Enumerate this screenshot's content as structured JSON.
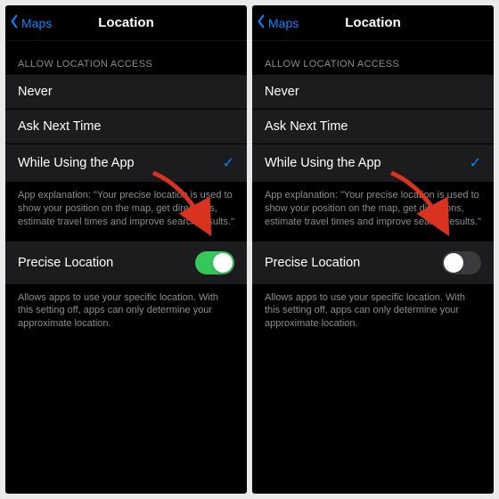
{
  "screens": [
    {
      "back_label": "Maps",
      "title": "Location",
      "section_header": "Allow Location Access",
      "options": [
        {
          "label": "Never",
          "selected": false
        },
        {
          "label": "Ask Next Time",
          "selected": false
        },
        {
          "label": "While Using the App",
          "selected": true
        }
      ],
      "explain": "App explanation: \"Your precise location is used to show your position on the map, get directions, estimate travel times and improve search results.\"",
      "precise_label": "Precise Location",
      "precise_on": true,
      "precise_footer": "Allows apps to use your specific location. With this setting off, apps can only determine your approximate location."
    },
    {
      "back_label": "Maps",
      "title": "Location",
      "section_header": "Allow Location Access",
      "options": [
        {
          "label": "Never",
          "selected": false
        },
        {
          "label": "Ask Next Time",
          "selected": false
        },
        {
          "label": "While Using the App",
          "selected": true
        }
      ],
      "explain": "App explanation: \"Your precise location is used to show your position on the map, get directions, estimate travel times and improve search results.\"",
      "precise_label": "Precise Location",
      "precise_on": false,
      "precise_footer": "Allows apps to use your specific location. With this setting off, apps can only determine your approximate location."
    }
  ],
  "colors": {
    "accent": "#0a84ff",
    "toggle_on": "#34c759",
    "arrow": "#d9321f"
  }
}
